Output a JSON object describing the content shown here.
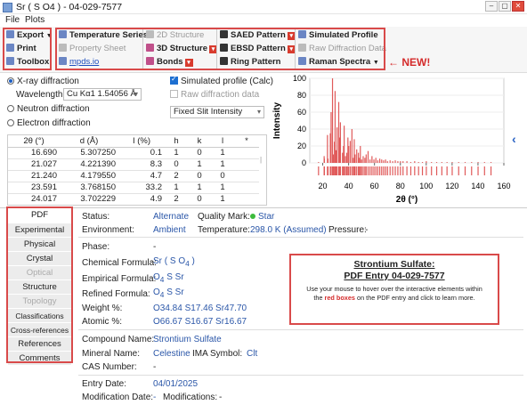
{
  "window": {
    "title": "Sr ( S O4 ) - 04-029-7577",
    "controls": [
      "–",
      "▢",
      "✕"
    ]
  },
  "menu": [
    "File",
    "Plots"
  ],
  "toolbar": {
    "export": "Export",
    "print": "Print",
    "toolbox": "Toolbox",
    "temperature_series": "Temperature Series",
    "property_sheet": "Property Sheet",
    "mpds": "mpds.io",
    "structure_2d": "2D Structure",
    "structure_3d": "3D Structure",
    "bonds": "Bonds",
    "saed": "SAED Pattern",
    "ebsd": "EBSD Pattern",
    "ring": "Ring Pattern",
    "simulated_profile": "Simulated Profile",
    "raw_diffraction": "Raw Diffraction Data",
    "raman": "Raman Spectra",
    "new_label": "← NEW!"
  },
  "diffraction": {
    "xray": "X-ray diffraction",
    "neutron": "Neutron diffraction",
    "electron": "Electron diffraction",
    "wavelength_label": "Wavelength:",
    "wavelength_value": "Cu Kα1 1.54056 Å",
    "simulated_profile": "Simulated profile (Calc)",
    "raw_data": "Raw diffraction data",
    "slit": "Fixed Slit Intensity"
  },
  "peaks": {
    "headers": [
      "2θ (°)",
      "d (Å)",
      "I (%)",
      "h",
      "k",
      "l",
      "*"
    ],
    "rows": [
      [
        "16.690",
        "5.307250",
        "0.1",
        "1",
        "0",
        "1",
        ""
      ],
      [
        "21.027",
        "4.221390",
        "8.3",
        "0",
        "1",
        "1",
        ""
      ],
      [
        "21.240",
        "4.179550",
        "4.7",
        "2",
        "0",
        "0",
        ""
      ],
      [
        "23.591",
        "3.768150",
        "33.2",
        "1",
        "1",
        "1",
        ""
      ],
      [
        "24.017",
        "3.702229",
        "4.9",
        "2",
        "0",
        "1",
        ""
      ]
    ]
  },
  "chart_data": {
    "type": "bar",
    "xlabel": "2θ (°)",
    "ylabel": "Intensity",
    "xlim": [
      10,
      160
    ],
    "ylim": [
      0,
      100
    ],
    "xticks": [
      20,
      40,
      60,
      80,
      100,
      120,
      140,
      160
    ],
    "yticks": [
      0,
      20,
      40,
      60,
      80,
      100
    ],
    "x": [
      16.69,
      21.03,
      21.24,
      23.59,
      24.02,
      25.8,
      26.4,
      27.5,
      28.2,
      29.0,
      29.5,
      30.2,
      31.0,
      32.3,
      33.0,
      33.6,
      35.2,
      36.0,
      36.5,
      37.5,
      38.5,
      39.4,
      40.0,
      41.2,
      42.5,
      43.6,
      44.3,
      45.0,
      46.2,
      47.5,
      48.3,
      49.0,
      50.0,
      51.2,
      52.5,
      53.5,
      55.0,
      56.5,
      58.0,
      59.5,
      61.0,
      62.5,
      64.0,
      65.5,
      67.0,
      68.5,
      70.0,
      72.0,
      74.0,
      76.0,
      78.0,
      80.0,
      82.0,
      85.0,
      88.0,
      91.0,
      94.0,
      97.0,
      100.0,
      104.0,
      108.0,
      112.0,
      116.0,
      120.0,
      125.0,
      130.0,
      135.0,
      140.0,
      145.0,
      150.0
    ],
    "values": [
      1,
      8,
      5,
      33,
      5,
      35,
      60,
      100,
      10,
      25,
      85,
      15,
      42,
      72,
      30,
      48,
      12,
      20,
      44,
      8,
      12,
      30,
      20,
      26,
      40,
      6,
      28,
      10,
      16,
      12,
      6,
      20,
      4,
      8,
      6,
      10,
      14,
      4,
      8,
      4,
      6,
      3,
      5,
      4,
      3,
      4,
      2,
      3,
      2,
      3,
      2,
      2,
      2,
      2,
      1,
      2,
      1,
      1,
      2,
      1,
      1,
      1,
      1,
      1,
      1,
      1,
      1,
      1,
      1,
      1
    ],
    "color": "#e05a5a"
  },
  "tabs": [
    "PDF",
    "Experimental",
    "Physical",
    "Crystal",
    "Optical",
    "Structure",
    "Topology",
    "Classifications",
    "Cross-references",
    "References",
    "Comments"
  ],
  "entry": {
    "status_label": "Status:",
    "status": "Alternate",
    "quality_label": "Quality Mark:",
    "quality": "Star",
    "environment_label": "Environment:",
    "environment": "Ambient",
    "temperature_label": "Temperature:",
    "temperature": "298.0 K (Assumed)",
    "pressure_label": "Pressure:",
    "pressure": "-",
    "phase_label": "Phase:",
    "phase": "-",
    "chemical_label": "Chemical Formula:",
    "chemical": "Sr ( S O",
    "chemical_sub": "4",
    "chemical_end": " )",
    "empirical_label": "Empirical Formula:",
    "empirical": "O",
    "empirical_sub": "4",
    "empirical_end": " S Sr",
    "refined_label": "Refined Formula:",
    "refined": "O",
    "refined_sub": "4",
    "refined_end": " S Sr",
    "weight_label": "Weight %:",
    "weight": "O34.84 S17.46 Sr47.70",
    "atomic_label": "Atomic %:",
    "atomic": "O66.67 S16.67 Sr16.67",
    "compound_label": "Compound Name:",
    "compound": "Strontium Sulfate",
    "mineral_label": "Mineral Name:",
    "mineral": "Celestine",
    "ima_label": "IMA Symbol:",
    "ima": "Clt",
    "cas_label": "CAS Number:",
    "cas": "-",
    "entry_date_label": "Entry Date:",
    "entry_date": "04/01/2025",
    "mod_label": "Modification Date:",
    "mod": "-",
    "mods_label": "Modifications:",
    "mods": "-"
  },
  "infobox": {
    "title1": "Strontium Sulfate:",
    "title2": "PDF Entry 04-029-7577",
    "text1": "Use your mouse to hover over the interactive elements within",
    "text2a": "the ",
    "text2b": "red boxes",
    "text2c": " on the PDF entry and click to learn more."
  }
}
